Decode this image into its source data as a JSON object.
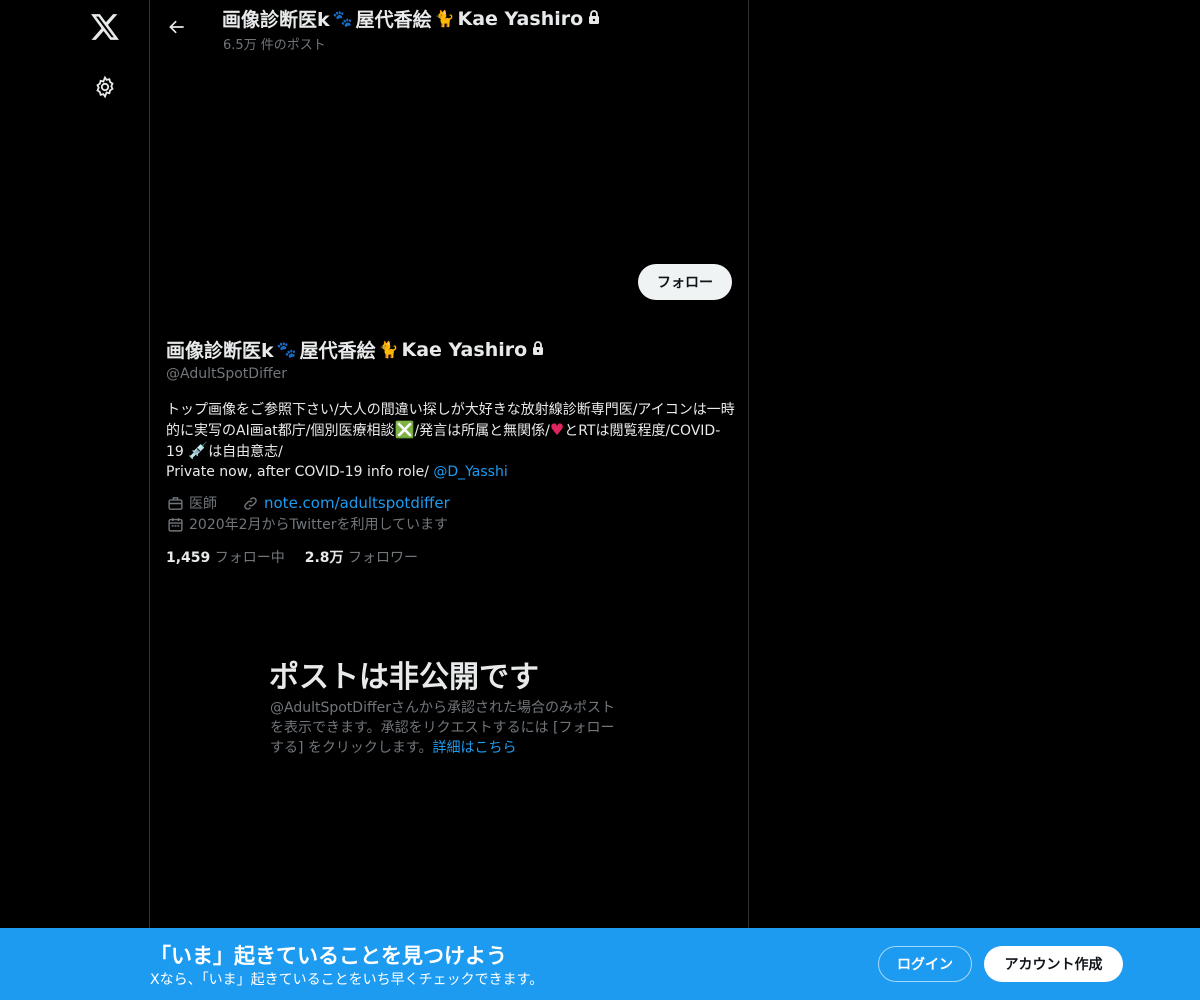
{
  "nav": {
    "logo_icon": "x-logo-icon",
    "settings_icon": "gear-icon"
  },
  "header": {
    "name_prefix": "画像診断医k",
    "name_mid": "屋代香絵",
    "name_suffix": "Kae Yashiro",
    "post_count": "6.5万 件のポスト"
  },
  "profile": {
    "follow_label": "フォロー",
    "name_prefix": "画像診断医k",
    "name_mid": "屋代香絵",
    "name_suffix": "Kae Yashiro",
    "handle": "@AdultSpotDiffer",
    "bio_part1": "トップ画像をご参照下さい/大人の間違い探しが大好きな放射線診断専門医/アイコンは一時的に実写のAI画at都庁/個別医療相談",
    "bio_part2": "/発言は所属と無関係/",
    "bio_part3": "とRTは閲覧程度/COVID-19 ",
    "bio_part4": "は自由意志/",
    "bio_line2": "Private now, after COVID-19 info role/ ",
    "bio_mention": "@D_Yasshi",
    "profession": "医師",
    "website": "note.com/adultspotdiffer",
    "joined": "2020年2月からTwitterを利用しています",
    "following_count": "1,459",
    "following_label": "フォロー中",
    "followers_count": "2.8万",
    "followers_label": "フォロワー"
  },
  "private_notice": {
    "title": "ポストは非公開です",
    "desc": "@AdultSpotDifferさんから承認された場合のみポストを表示できます。承認をリクエストするには [フォローする] をクリックします。",
    "learn_more": "詳細はこちら"
  },
  "banner": {
    "title": "「いま」起きていることを見つけよう",
    "subtitle": "Xなら、「いま」起きていることをいち早くチェックできます。",
    "login_label": "ログイン",
    "signup_label": "アカウント作成"
  },
  "colors": {
    "accent": "#1d9bf0",
    "background": "#000000",
    "muted_text": "#71767b"
  }
}
